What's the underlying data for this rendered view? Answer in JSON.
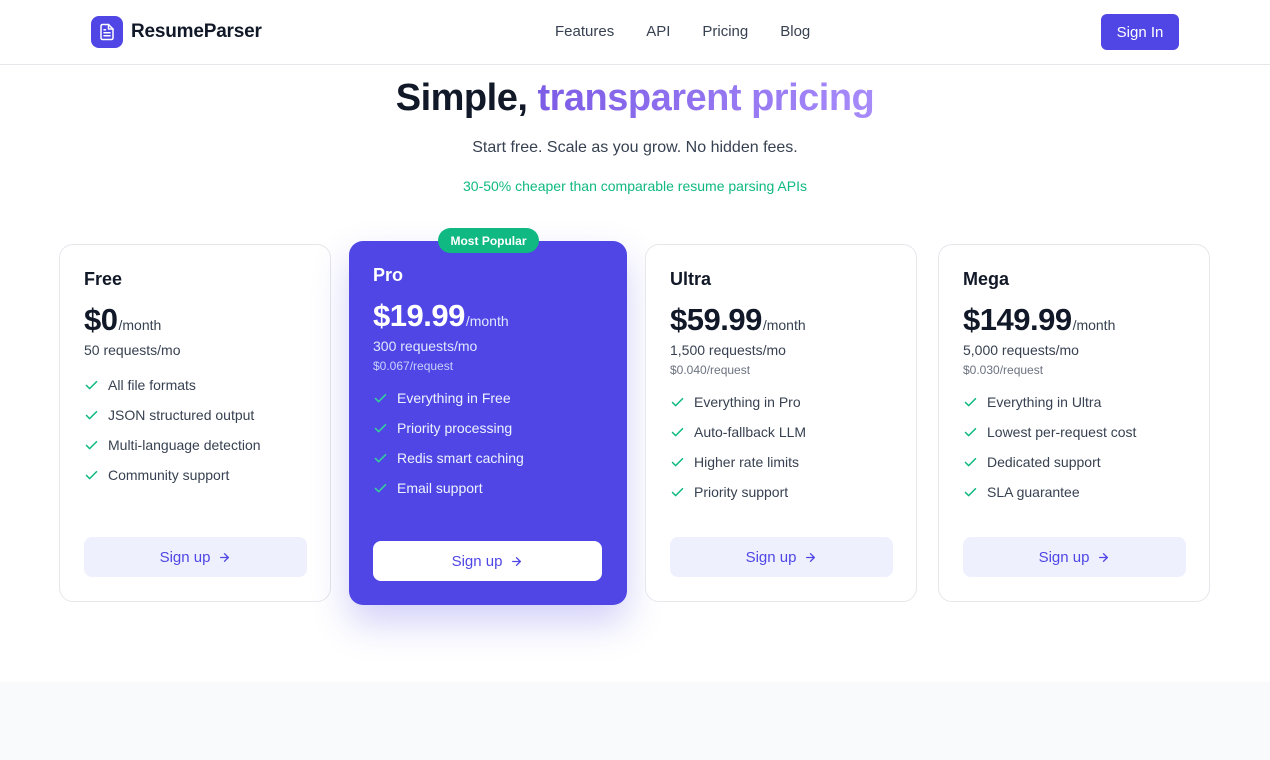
{
  "brand": {
    "name": "ResumeParser",
    "logo_icon": "document-icon"
  },
  "nav": {
    "items": [
      "Features",
      "API",
      "Pricing",
      "Blog"
    ]
  },
  "header": {
    "signin_label": "Sign In"
  },
  "hero": {
    "title_plain": "Simple,",
    "title_accent": "transparent pricing",
    "subtitle": "Start free. Scale as you grow. No hidden fees.",
    "note": "30-50% cheaper than comparable resume parsing APIs"
  },
  "colors": {
    "accent": "#4f46e5",
    "success": "#10b981",
    "gradient_start": "#7c5ce6",
    "gradient_end": "#a78bfa"
  },
  "plans": [
    {
      "name": "Free",
      "price": "$0",
      "period": "/month",
      "requests": "50 requests/mo",
      "per_request": "",
      "features": [
        "All file formats",
        "JSON structured output",
        "Multi-language detection",
        "Community support"
      ],
      "cta": "Sign up",
      "popular": false
    },
    {
      "name": "Pro",
      "price": "$19.99",
      "period": "/month",
      "requests": "300 requests/mo",
      "per_request": "$0.067/request",
      "features": [
        "Everything in Free",
        "Priority processing",
        "Redis smart caching",
        "Email support"
      ],
      "cta": "Sign up",
      "popular": true,
      "badge": "Most Popular"
    },
    {
      "name": "Ultra",
      "price": "$59.99",
      "period": "/month",
      "requests": "1,500 requests/mo",
      "per_request": "$0.040/request",
      "features": [
        "Everything in Pro",
        "Auto-fallback LLM",
        "Higher rate limits",
        "Priority support"
      ],
      "cta": "Sign up",
      "popular": false
    },
    {
      "name": "Mega",
      "price": "$149.99",
      "period": "/month",
      "requests": "5,000 requests/mo",
      "per_request": "$0.030/request",
      "features": [
        "Everything in Ultra",
        "Lowest per-request cost",
        "Dedicated support",
        "SLA guarantee"
      ],
      "cta": "Sign up",
      "popular": false
    }
  ]
}
